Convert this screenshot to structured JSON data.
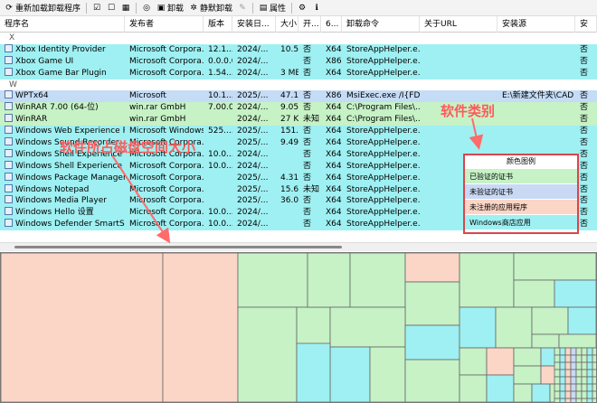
{
  "toolbar": {
    "reload_label": "重新加载卸载程序",
    "uninstall_label": "卸载",
    "quiet_uninstall_label": "静默卸载",
    "properties_label": "属性"
  },
  "columns": [
    "程序名",
    "发布者",
    "版本",
    "安装日...",
    "大小",
    "开...",
    "6...",
    "卸载命令",
    "关于URL",
    "安装源",
    "安"
  ],
  "rows": [
    {
      "kind": "group",
      "name": "X"
    },
    {
      "kind": "store",
      "name": "Xbox Identity Provider",
      "publisher": "Microsoft Corpora...",
      "version": "12.1...",
      "date": "2024/...",
      "size": "10.5 ...",
      "open": "否",
      "arch": "X64",
      "cmd": "StoreAppHelper.e...",
      "url": "",
      "source": "",
      "last": "否"
    },
    {
      "kind": "store",
      "name": "Xbox Game UI",
      "publisher": "Microsoft Corpora...",
      "version": "0.0.0.0",
      "date": "2024/...",
      "size": "",
      "open": "否",
      "arch": "X86",
      "cmd": "StoreAppHelper.e...",
      "url": "",
      "source": "",
      "last": "否"
    },
    {
      "kind": "store",
      "name": "Xbox Game Bar Plugin",
      "publisher": "Microsoft Corpora...",
      "version": "1.54....",
      "date": "2024/...",
      "size": "3 MB",
      "open": "否",
      "arch": "X64",
      "cmd": "StoreAppHelper.e...",
      "url": "",
      "source": "",
      "last": "否"
    },
    {
      "kind": "group",
      "name": "W"
    },
    {
      "kind": "selected",
      "name": "WPTx64",
      "publisher": "Microsoft",
      "version": "10.1....",
      "date": "2025/...",
      "size": "47.16 ...",
      "open": "否",
      "arch": "X86",
      "cmd": "MsiExec.exe /I{FD4...",
      "url": "",
      "source": "E:\\新建文件夹\\CAD ...",
      "last": "否"
    },
    {
      "kind": "verified",
      "name": "WinRAR 7.00 (64-位)",
      "publisher": "win.rar GmbH",
      "version": "7.00.0",
      "date": "2024/...",
      "size": "9.05 ...",
      "open": "否",
      "arch": "X64",
      "cmd": "C:\\Program Files\\...",
      "url": "",
      "source": "",
      "last": "否"
    },
    {
      "kind": "verified",
      "name": "WinRAR",
      "publisher": "win.rar GmbH",
      "version": "",
      "date": "2024/...",
      "size": "27 KB",
      "open": "未知",
      "arch": "X64",
      "cmd": "C:\\Program Files\\...",
      "url": "",
      "source": "",
      "last": "否"
    },
    {
      "kind": "store",
      "name": "Windows Web Experience Pa...",
      "publisher": "Microsoft Windows",
      "version": "525....",
      "date": "2025/...",
      "size": "151.6...",
      "open": "否",
      "arch": "X64",
      "cmd": "StoreAppHelper.e...",
      "url": "",
      "source": "",
      "last": "否"
    },
    {
      "kind": "store",
      "name": "Windows Sound Recorder",
      "publisher": "Microsoft Corpora...",
      "version": "",
      "date": "2025/...",
      "size": "9.49 ...",
      "open": "否",
      "arch": "X64",
      "cmd": "StoreAppHelper.e...",
      "url": "",
      "source": "",
      "last": "否"
    },
    {
      "kind": "store",
      "name": "Windows Shell Experience ...",
      "publisher": "Microsoft Corpora...",
      "version": "10.0....",
      "date": "2024/...",
      "size": "",
      "open": "否",
      "arch": "X64",
      "cmd": "StoreAppHelper.e...",
      "url": "",
      "source": "",
      "last": "否"
    },
    {
      "kind": "store",
      "name": "Windows Shell Experience ...",
      "publisher": "Microsoft Corpora...",
      "version": "10.0....",
      "date": "2024/...",
      "size": "",
      "open": "否",
      "arch": "X64",
      "cmd": "StoreAppHelper.e...",
      "url": "",
      "source": "",
      "last": "否"
    },
    {
      "kind": "store",
      "name": "Windows Package Manager...",
      "publisher": "Microsoft Corpora...",
      "version": "",
      "date": "2025/...",
      "size": "4.31 ...",
      "open": "否",
      "arch": "X64",
      "cmd": "StoreAppHelper.e...",
      "url": "",
      "source": "",
      "last": "否"
    },
    {
      "kind": "store",
      "name": "Windows Notepad",
      "publisher": "Microsoft Corpora...",
      "version": "",
      "date": "2025/...",
      "size": "15.68 ...",
      "open": "未知",
      "arch": "X64",
      "cmd": "StoreAppHelper.e...",
      "url": "",
      "source": "",
      "last": "否"
    },
    {
      "kind": "store",
      "name": "Windows Media Player",
      "publisher": "Microsoft Corpora...",
      "version": "",
      "date": "2025/...",
      "size": "36.09 ...",
      "open": "否",
      "arch": "X64",
      "cmd": "StoreAppHelper.e...",
      "url": "",
      "source": "",
      "last": "否"
    },
    {
      "kind": "store",
      "name": "Windows Hello 设置",
      "publisher": "Microsoft Corpora...",
      "version": "10.0....",
      "date": "2024/...",
      "size": "",
      "open": "否",
      "arch": "X64",
      "cmd": "StoreAppHelper.e...",
      "url": "",
      "source": "",
      "last": "否"
    },
    {
      "kind": "store",
      "name": "Windows Defender SmartScr...",
      "publisher": "Microsoft Corpora...",
      "version": "10.0....",
      "date": "2024/...",
      "size": "",
      "open": "否",
      "arch": "X64",
      "cmd": "StoreAppHelper.e...",
      "url": "",
      "source": "",
      "last": "否"
    }
  ],
  "legend": {
    "title": "颜色图例",
    "items": [
      {
        "label": "已验证的证书",
        "color": "#c6f2c6"
      },
      {
        "label": "未验证的证书",
        "color": "#c9d9f4"
      },
      {
        "label": "未注册的应用程序",
        "color": "#fbd6c6"
      },
      {
        "label": "Windows商店应用",
        "color": "#9ff0f2"
      }
    ]
  },
  "annotations": {
    "category": "软件类别",
    "disk_usage": "软件所占磁盘空间大小"
  },
  "colors": {
    "store": "#9ff0f2",
    "verified": "#c6f2c6",
    "unverified": "#c9d9f4",
    "unregistered": "#fbd6c6",
    "annotation": "#ff5a5a"
  }
}
